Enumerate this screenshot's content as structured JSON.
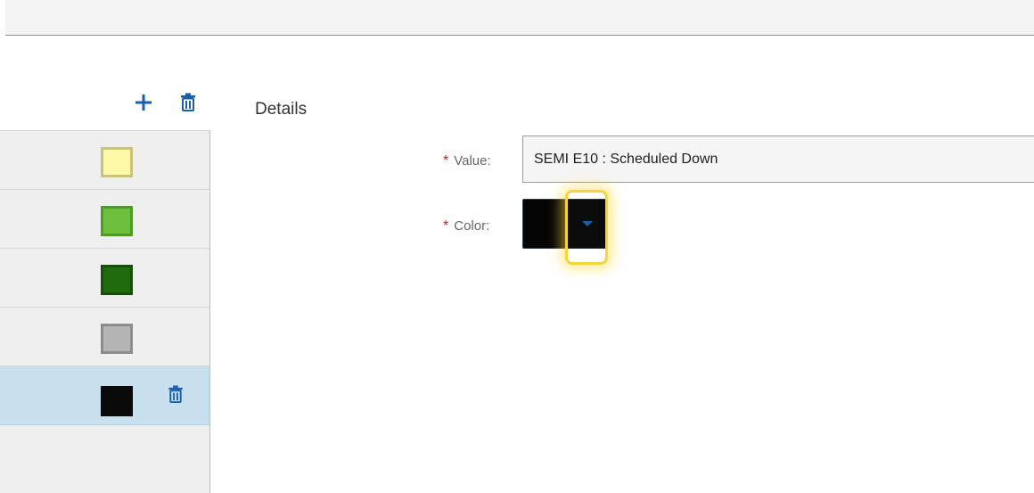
{
  "toolbar": {
    "add_icon": "plus-icon",
    "delete_icon": "trash-icon"
  },
  "list": {
    "rows": [
      {
        "color": "#fef9a8",
        "border": "#c9c37a",
        "selected": false
      },
      {
        "color": "#6fbf3f",
        "border": "#4e9a27",
        "selected": false
      },
      {
        "color": "#1f6b0e",
        "border": "#154f08",
        "selected": false
      },
      {
        "color": "#b4b4b4",
        "border": "#8c8c8c",
        "selected": false
      },
      {
        "color": "#0a0a0a",
        "border": "#0a0a0a",
        "selected": true,
        "delete_icon": "trash-icon"
      }
    ]
  },
  "details": {
    "title": "Details",
    "required_marker": "*",
    "value_label": "Value:",
    "value": "SEMI E10 : Scheduled Down",
    "color_label": "Color:",
    "color_value": "#050505"
  },
  "colors": {
    "accent": "#1a5fa8",
    "required": "#b0282a",
    "highlight": "#f5d53b",
    "selected_row": "#c8dfee"
  }
}
